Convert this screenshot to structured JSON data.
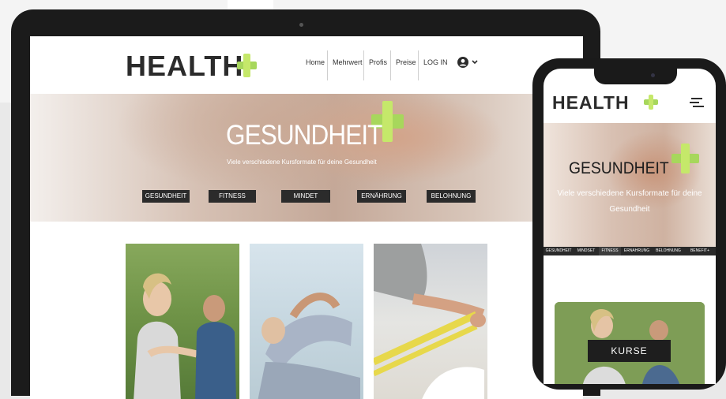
{
  "brand": {
    "logo_text": "HEALTH",
    "accent": "#a7d75c",
    "dark": "#2b2b2b"
  },
  "laptop": {
    "nav": {
      "items": [
        "Home",
        "Mehrwert",
        "Profis",
        "Preise"
      ],
      "login": "LOG IN"
    },
    "hero": {
      "title": "GESUNDHEIT",
      "subtitle": "Viele verschiedene Kursformate für deine Gesundheit",
      "categories": [
        "GESUNDHEIT",
        "FITNESS",
        "MINDET",
        "ERNÄHRUNG",
        "BELOHNUNG"
      ]
    },
    "cards": [
      "yoga-photo",
      "stretching-photo",
      "resistance-band-photo"
    ]
  },
  "phone": {
    "hero": {
      "title": "GESUNDHEIT",
      "subtitle": "Viele verschiedene Kursformate für deine Gesundheit"
    },
    "categories": [
      "GESUNDHEIT",
      "MINDSET",
      "FITNESS",
      "ERNAHRUNG",
      "BELOHNUNG",
      "BENEFIT+"
    ],
    "card_button": "KURSE"
  }
}
